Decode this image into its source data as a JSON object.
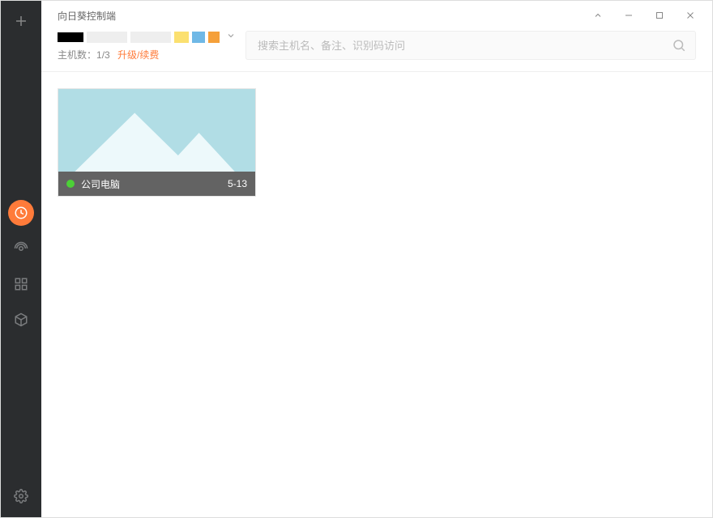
{
  "app": {
    "title": "向日葵控制端"
  },
  "header": {
    "host_count_label": "主机数：",
    "host_count_value": "1/3",
    "upgrade_label": "升级/续费"
  },
  "search": {
    "placeholder": "搜索主机名、备注、识别码访问"
  },
  "hosts": [
    {
      "name": "公司电脑",
      "date": "5-13",
      "status": "online"
    }
  ],
  "colors": {
    "accent": "#ff7b3a",
    "status_online": "#4cd137",
    "sidebar_bg": "#2b2d2f"
  }
}
